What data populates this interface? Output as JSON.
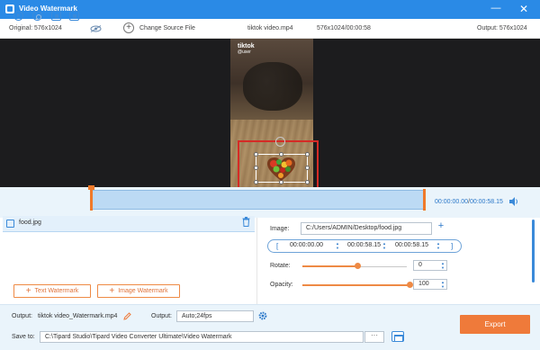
{
  "window": {
    "title": "Video Watermark",
    "minimize_glyph": "—",
    "close_glyph": "✕"
  },
  "infobar": {
    "original": "Original: 576x1024",
    "change_source": "Change Source File",
    "file_name": "tiktok video.mp4",
    "resolution_duration": "576x1024/00:00:58",
    "output": "Output: 576x1024"
  },
  "preview": {
    "tiktok_logo": "tiktok",
    "tiktok_handle": "@user"
  },
  "playback": {
    "current_time": "00:00:00.00",
    "separator": "/",
    "total_time": "00:00:58.15"
  },
  "watermark_list": {
    "items": [
      {
        "name": "food.jpg"
      }
    ],
    "text_watermark_label": "Text Watermark",
    "image_watermark_label": "Image Watermark"
  },
  "settings": {
    "image_label": "Image:",
    "image_path": "C:/Users/ADMIN/Desktop/food.jpg",
    "start_time": "00:00:00.00",
    "duration_time": "00:00:58.15",
    "end_time": "00:00:58.15",
    "rotate_label": "Rotate:",
    "rotate_value": "0",
    "rotate_level": 0.0,
    "opacity_label": "Opacity:",
    "opacity_value": "100",
    "opacity_level": 1.0
  },
  "bottom": {
    "output_label": "Output:",
    "output_file": "tiktok video_Watermark.mp4",
    "output_format_label": "Output:",
    "output_format": "Auto;24fps",
    "save_to_label": "Save to:",
    "save_path": "C:\\Tipard Studio\\Tipard Video Converter Ultimate\\Video Watermark",
    "browse_label": "···",
    "export_label": "Export"
  },
  "colors": {
    "titlebar": "#2a8ae6",
    "accent_orange": "#ef7a3a",
    "selection_red": "#d52b26",
    "accent_blue": "#2b78c9"
  },
  "icons": [
    "app-logo-icon",
    "minimize-icon",
    "close-icon",
    "eye-icon",
    "add-icon",
    "play-icon",
    "stop-icon",
    "next-frame-icon",
    "snapshot-icon",
    "volume-icon",
    "image-file-icon",
    "trash-icon",
    "pencil-icon",
    "gear-icon",
    "folder-icon"
  ]
}
